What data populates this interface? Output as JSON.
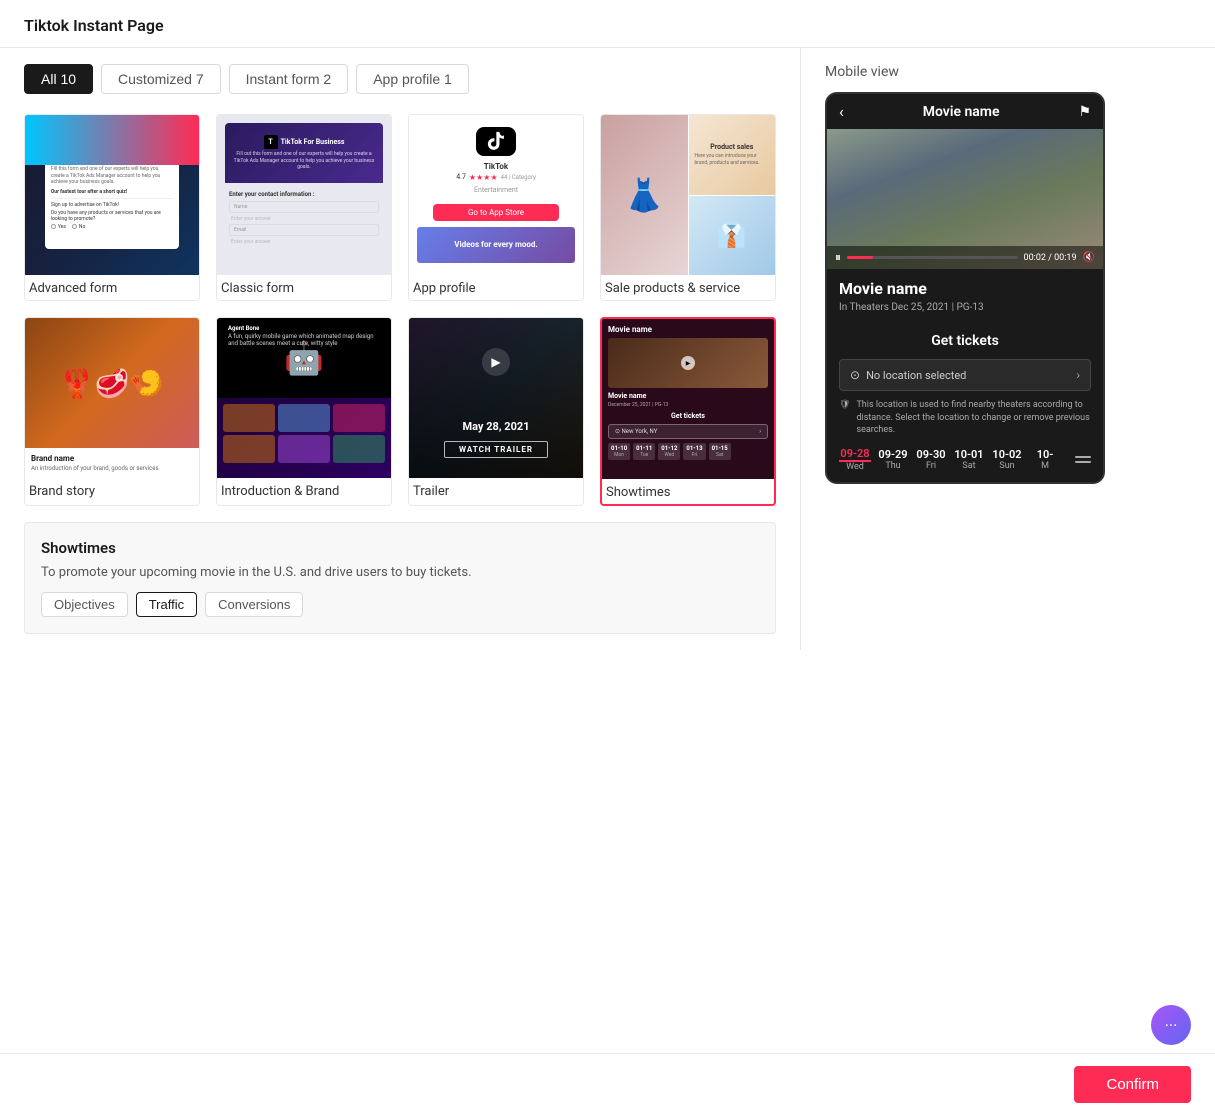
{
  "page": {
    "title": "Tiktok Instant Page"
  },
  "filters": [
    {
      "label": "All 10",
      "active": true
    },
    {
      "label": "Customized 7",
      "active": false
    },
    {
      "label": "Instant form 2",
      "active": false
    },
    {
      "label": "App profile 1",
      "active": false
    }
  ],
  "templates": [
    {
      "id": "advanced-form",
      "label": "Advanced form",
      "type": "form"
    },
    {
      "id": "classic-form",
      "label": "Classic form",
      "type": "form"
    },
    {
      "id": "app-profile",
      "label": "App profile",
      "type": "app"
    },
    {
      "id": "sale-products",
      "label": "Sale products & service",
      "type": "sale"
    },
    {
      "id": "brand-story",
      "label": "Brand story",
      "type": "brand"
    },
    {
      "id": "intro-brand",
      "label": "Introduction & Brand",
      "type": "intro"
    },
    {
      "id": "trailer",
      "label": "Trailer",
      "type": "trailer"
    },
    {
      "id": "showtimes",
      "label": "Showtimes",
      "type": "showtime",
      "selected": true
    }
  ],
  "description": {
    "title": "Showtimes",
    "text": "To promote your upcoming movie in the U.S. and drive users to buy tickets.",
    "objectives": [
      {
        "label": "Objectives",
        "selected": false
      },
      {
        "label": "Traffic",
        "selected": true
      },
      {
        "label": "Conversions",
        "selected": false
      }
    ]
  },
  "mobileView": {
    "title": "Mobile view",
    "movieTitle": "Movie name",
    "movieMeta": "In Theaters  Dec 25, 2021  |  PG-13",
    "videoTime": "00:02 / 00:19",
    "sectionTitle": "Get tickets",
    "locationPlaceholder": "No location selected",
    "locationNotice": "This location is used to find nearby theaters according to distance. Select the location to change or remove previous searches.",
    "dates": [
      {
        "num": "09-28",
        "day": "Wed",
        "selected": true
      },
      {
        "num": "09-29",
        "day": "Thu"
      },
      {
        "num": "09-30",
        "day": "Fri"
      },
      {
        "num": "10-01",
        "day": "Sat"
      },
      {
        "num": "10-02",
        "day": "Sun"
      },
      {
        "num": "10-",
        "day": "M"
      }
    ]
  },
  "buttons": {
    "confirm": "Confirm"
  },
  "chat": {
    "icon": "···"
  }
}
